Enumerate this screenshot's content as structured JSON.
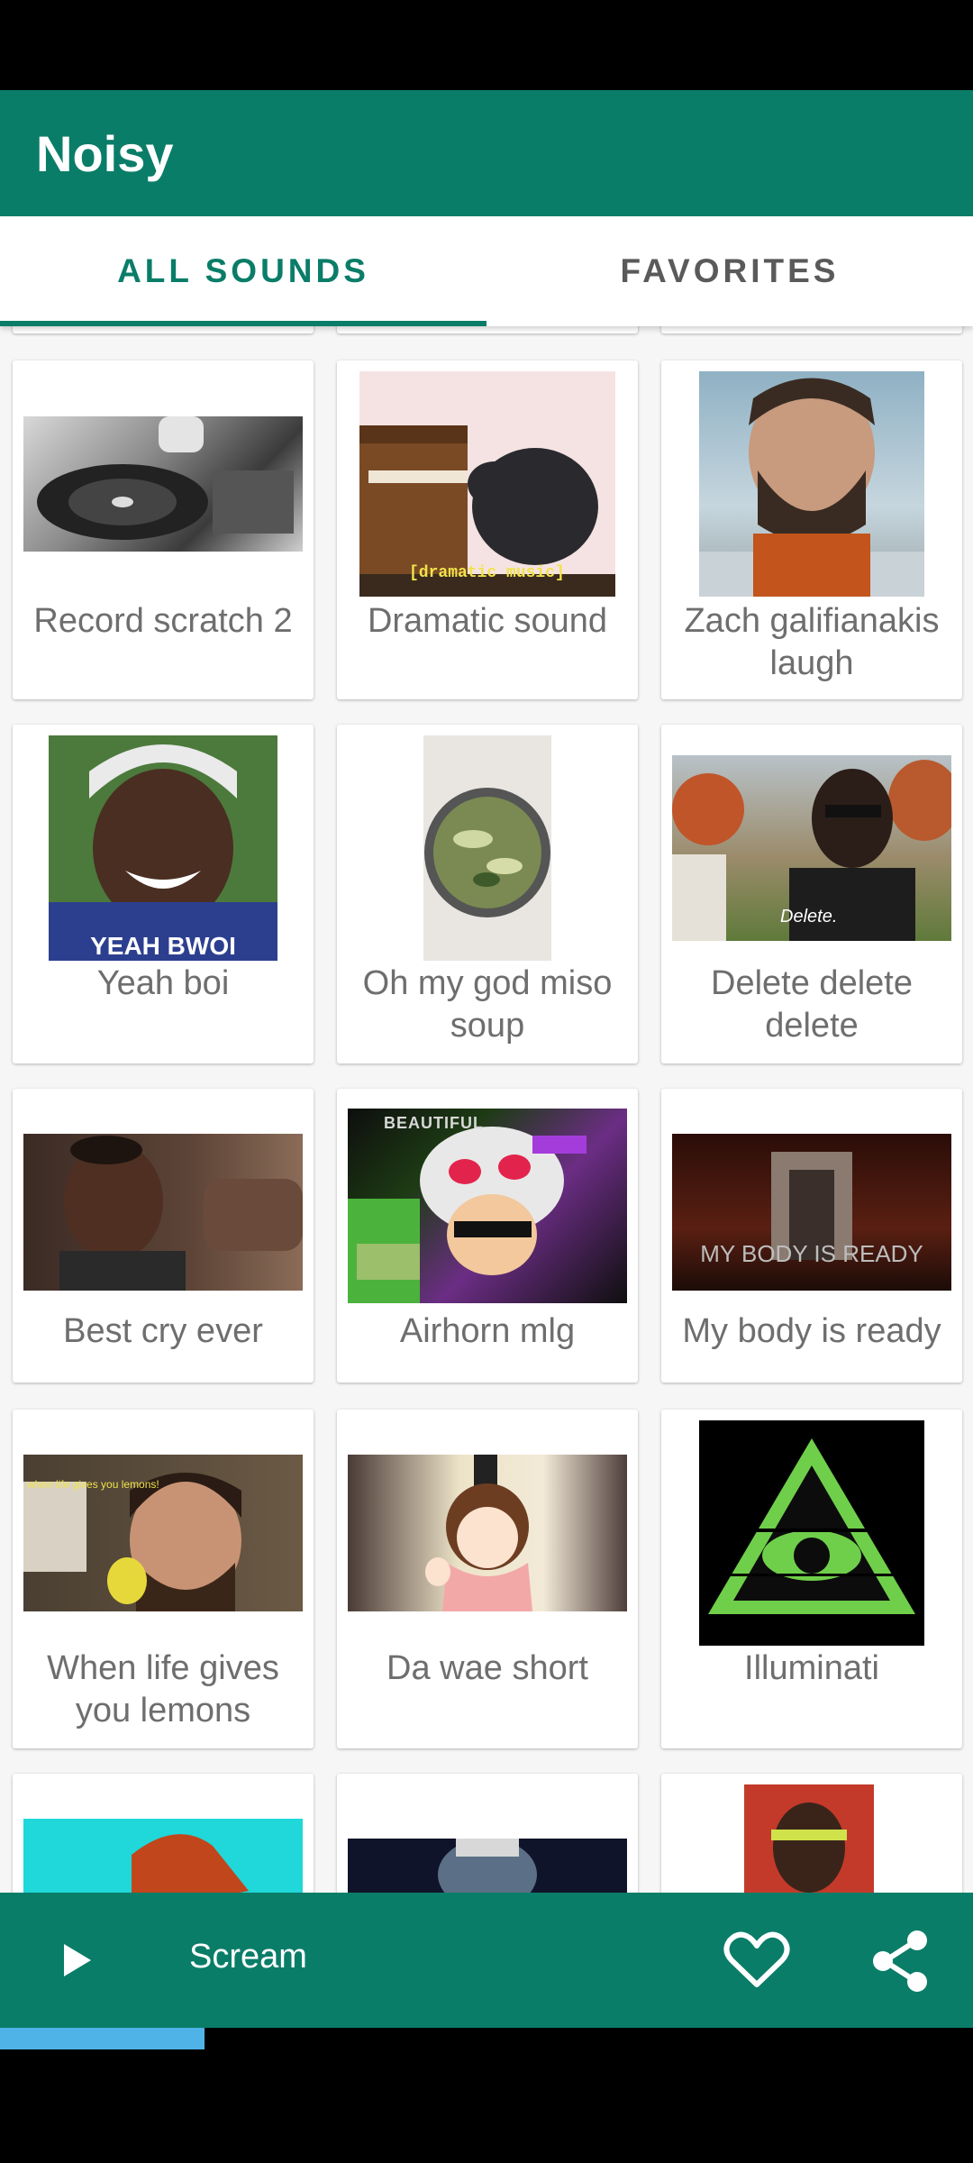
{
  "app": {
    "title": "Noisy"
  },
  "tabs": [
    {
      "label": "ALL SOUNDS",
      "selected": true
    },
    {
      "label": "FAVORITES",
      "selected": false
    }
  ],
  "sounds": [
    {
      "label": "Record scratch 2"
    },
    {
      "label": "Dramatic sound",
      "caption": "[dramatic music]"
    },
    {
      "label": "Zach galifianakis laugh"
    },
    {
      "label": "Yeah boi",
      "caption": "YEAH BWOI"
    },
    {
      "label": "Oh my god miso soup"
    },
    {
      "label": "Delete delete delete",
      "caption": "Delete."
    },
    {
      "label": "Best cry ever"
    },
    {
      "label": "Airhorn mlg",
      "caption": "BEAUTIFUL"
    },
    {
      "label": "My body is ready",
      "caption": "MY BODY IS READY"
    },
    {
      "label": "When life gives you lemons",
      "caption": "when life gives you lemons!"
    },
    {
      "label": "Da wae short"
    },
    {
      "label": "Illuminati"
    }
  ],
  "player": {
    "now_playing": "Scream",
    "progress": 0.21,
    "icons": {
      "play": "play-icon",
      "favorite": "heart-outline-icon",
      "share": "share-icon"
    }
  },
  "colors": {
    "primary": "#0a7d68",
    "progress": "#4fb3e8",
    "label": "#6e6e6e"
  }
}
